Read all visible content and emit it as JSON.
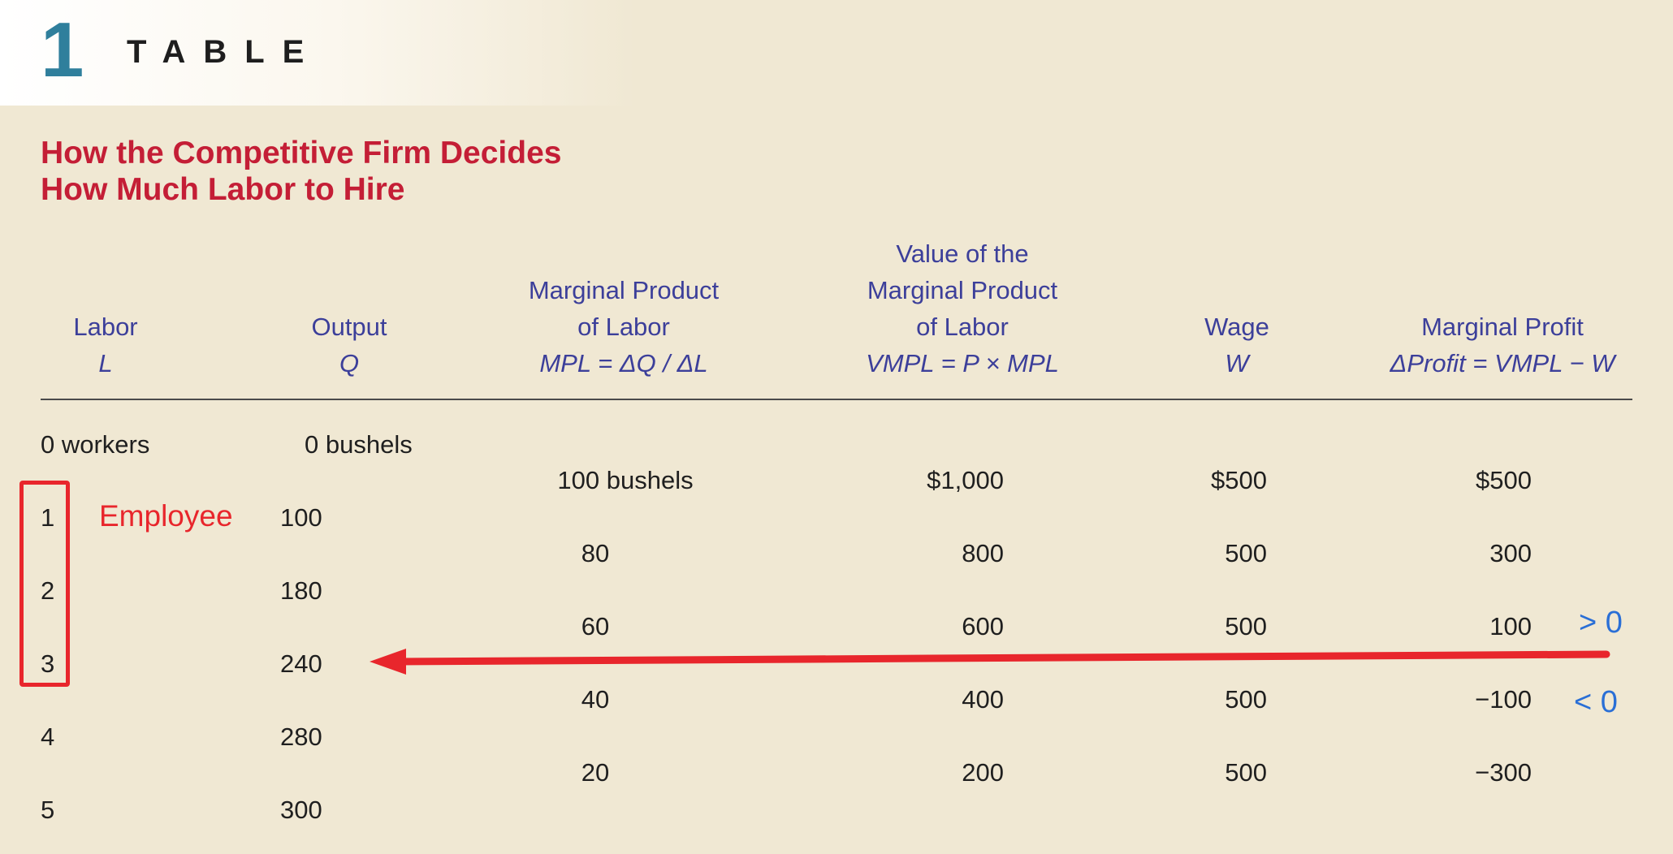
{
  "header": {
    "number": "1",
    "word": "TABLE"
  },
  "title": {
    "line1": "How the Competitive Firm Decides",
    "line2": "How Much Labor to Hire"
  },
  "columns": [
    {
      "lines": [
        "Labor"
      ],
      "symbol": "L"
    },
    {
      "lines": [
        "Output"
      ],
      "symbol": "Q"
    },
    {
      "lines": [
        "Marginal Product",
        "of Labor"
      ],
      "symbol": "MPL = ΔQ / ΔL"
    },
    {
      "lines": [
        "Value of the",
        "Marginal Product",
        "of Labor"
      ],
      "symbol": "VMPL = P × MPL"
    },
    {
      "lines": [
        "Wage"
      ],
      "symbol": "W"
    },
    {
      "lines": [
        "Marginal Profit"
      ],
      "symbol": "ΔProfit = VMPL − W"
    }
  ],
  "rows": [
    {
      "labor": "0 workers",
      "output": "0 bushels"
    },
    {
      "labor": "1",
      "output": "100"
    },
    {
      "labor": "2",
      "output": "180"
    },
    {
      "labor": "3",
      "output": "240"
    },
    {
      "labor": "4",
      "output": "280"
    },
    {
      "labor": "5",
      "output": "300"
    }
  ],
  "marginal_rows": [
    {
      "mpl": "100 bushels",
      "vmpl": "$1,000",
      "wage": "$500",
      "profit": "$500"
    },
    {
      "mpl": "80",
      "vmpl": "800",
      "wage": "500",
      "profit": "300"
    },
    {
      "mpl": "60",
      "vmpl": "600",
      "wage": "500",
      "profit": "100"
    },
    {
      "mpl": "40",
      "vmpl": "400",
      "wage": "500",
      "profit": "−100"
    },
    {
      "mpl": "20",
      "vmpl": "200",
      "wage": "500",
      "profit": "−300"
    }
  ],
  "annotations": {
    "employee": "Employee",
    "positive": "> 0",
    "negative": "< 0",
    "accent_color": "#e8262c",
    "sign_color": "#2a6fd6"
  }
}
